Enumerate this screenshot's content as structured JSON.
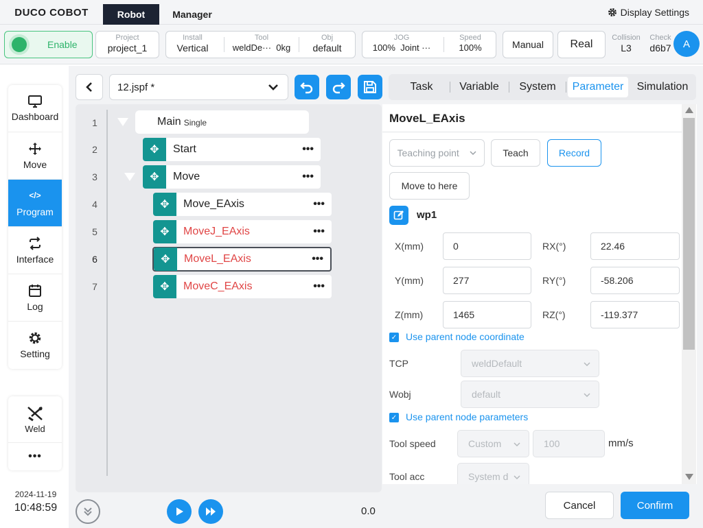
{
  "brand": "DUCO COBOT",
  "nav": {
    "robot": "Robot",
    "manager": "Manager",
    "display_settings": "Display Settings"
  },
  "status": {
    "enable": "Enable",
    "project_label": "Project",
    "project_value": "project_1",
    "install_label": "Install",
    "install_value": "Vertical",
    "tool_label": "Tool",
    "tool_value": "weldDe···",
    "tool_weight": "0kg",
    "obj_label": "Obj",
    "obj_value": "default",
    "jog_label": "JOG",
    "jog_value": "100%",
    "jog_mode": "Joint ···",
    "speed_label": "Speed",
    "speed_value": "100%",
    "manual": "Manual",
    "real": "Real",
    "collision_label": "Collision",
    "collision_value": "L3",
    "check_label": "Check",
    "check_value": "d6b7",
    "avatar": "A"
  },
  "sidebar": {
    "items": [
      {
        "label": "Dashboard",
        "icon": "□"
      },
      {
        "label": "Move",
        "icon": "✥"
      },
      {
        "label": "Program",
        "icon": "</>"
      },
      {
        "label": "Interface",
        "icon": "⇄"
      },
      {
        "label": "Log",
        "icon": "▦"
      },
      {
        "label": "Setting",
        "icon": "⚙"
      }
    ],
    "weld": "Weld",
    "more": "•••",
    "date": "2024-11-19",
    "time": "10:48:59"
  },
  "program": {
    "file": "12.jspf *",
    "line_numbers": [
      "1",
      "2",
      "3",
      "4",
      "5",
      "6",
      "7"
    ],
    "main_label": "Main",
    "main_sub": "Single",
    "nodes": {
      "start": "Start",
      "move": "Move",
      "move_eaxis": "Move_EAxis",
      "movej_eaxis": "MoveJ_EAxis",
      "movel_eaxis": "MoveL_EAxis",
      "movec_eaxis": "MoveC_EAxis"
    },
    "speed_readout": "0.0"
  },
  "tabs": {
    "task": "Task",
    "variable": "Variable",
    "system": "System",
    "parameter": "Parameter",
    "simulation": "Simulation"
  },
  "param": {
    "title": "MoveL_EAxis",
    "teaching_point": "Teaching point",
    "teach": "Teach",
    "record": "Record",
    "move_to_here": "Move to here",
    "wp_name": "wp1",
    "x_label": "X(mm)",
    "x_value": "0",
    "y_label": "Y(mm)",
    "y_value": "277",
    "z_label": "Z(mm)",
    "z_value": "1465",
    "rx_label": "RX(°)",
    "rx_value": "22.46",
    "ry_label": "RY(°)",
    "ry_value": "-58.206",
    "rz_label": "RZ(°)",
    "rz_value": "-119.377",
    "use_parent_coord": "Use parent node coordinate",
    "tcp_label": "TCP",
    "tcp_value": "weldDefault",
    "wobj_label": "Wobj",
    "wobj_value": "default",
    "use_parent_params": "Use parent node parameters",
    "tool_speed_label": "Tool speed",
    "tool_speed_mode": "Custom",
    "tool_speed_value": "100",
    "tool_speed_unit": "mm/s",
    "tool_acc_label": "Tool acc",
    "tool_acc_mode": "System d"
  },
  "actions": {
    "cancel": "Cancel",
    "confirm": "Confirm"
  },
  "colors": {
    "accent": "#1a93ee",
    "node_icon": "#139591",
    "error_red": "#e04545",
    "enable_green": "#2db36a"
  }
}
